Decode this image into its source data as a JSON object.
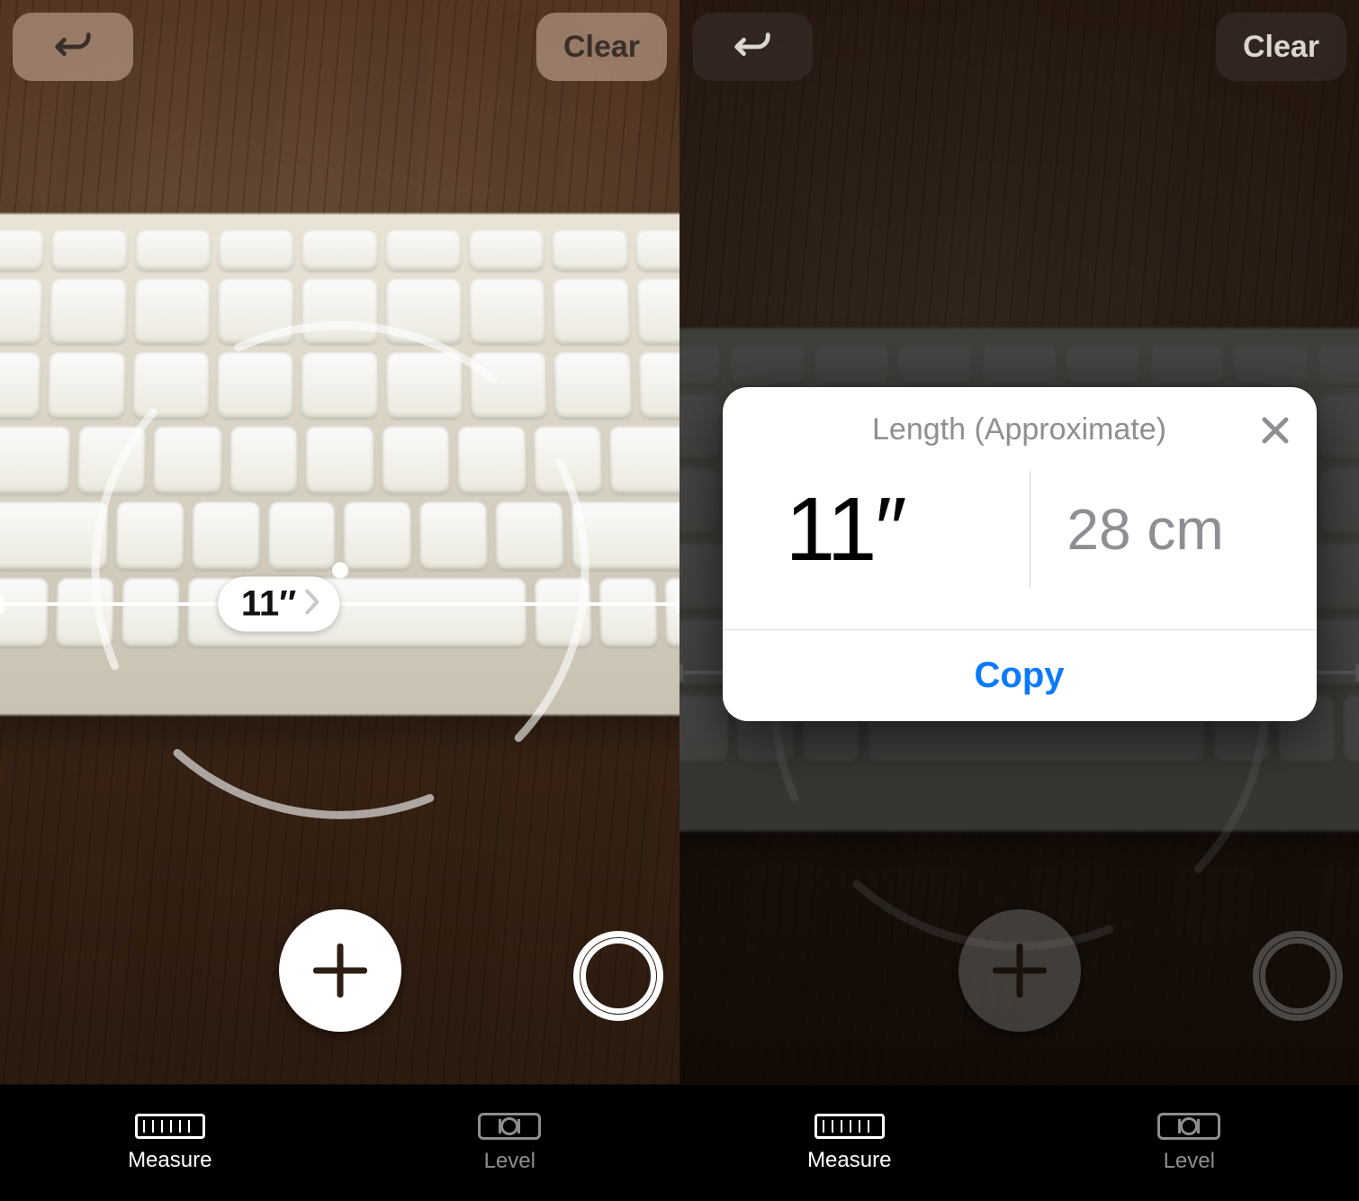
{
  "left": {
    "undo_label": "Undo",
    "clear_label": "Clear",
    "measurement_pill": "11″",
    "add_label": "Add point",
    "shutter_label": "Capture",
    "tabs": {
      "measure": "Measure",
      "level": "Level"
    }
  },
  "right": {
    "undo_label": "Undo",
    "clear_label": "Clear",
    "card": {
      "title": "Length (Approximate)",
      "primary_value": "11″",
      "secondary_value": "28 cm",
      "copy_label": "Copy",
      "close_label": "Close"
    },
    "add_label": "Add point",
    "shutter_label": "Capture",
    "tabs": {
      "measure": "Measure",
      "level": "Level"
    }
  }
}
